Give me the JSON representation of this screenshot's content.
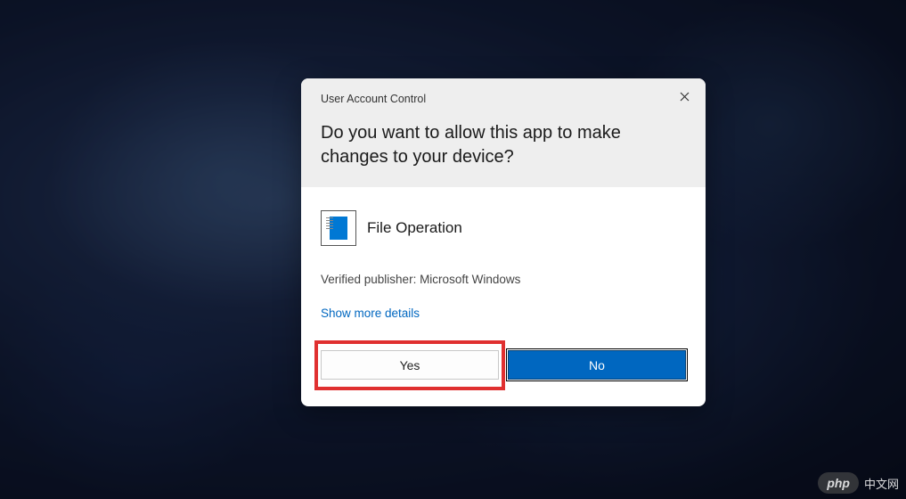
{
  "dialog": {
    "title_small": "User Account Control",
    "heading": "Do you want to allow this app to make changes to your device?",
    "app_name": "File Operation",
    "publisher_line": "Verified publisher: Microsoft Windows",
    "details_link": "Show more details",
    "yes_label": "Yes",
    "no_label": "No"
  },
  "watermark": {
    "badge": "php",
    "text": "中文网"
  }
}
